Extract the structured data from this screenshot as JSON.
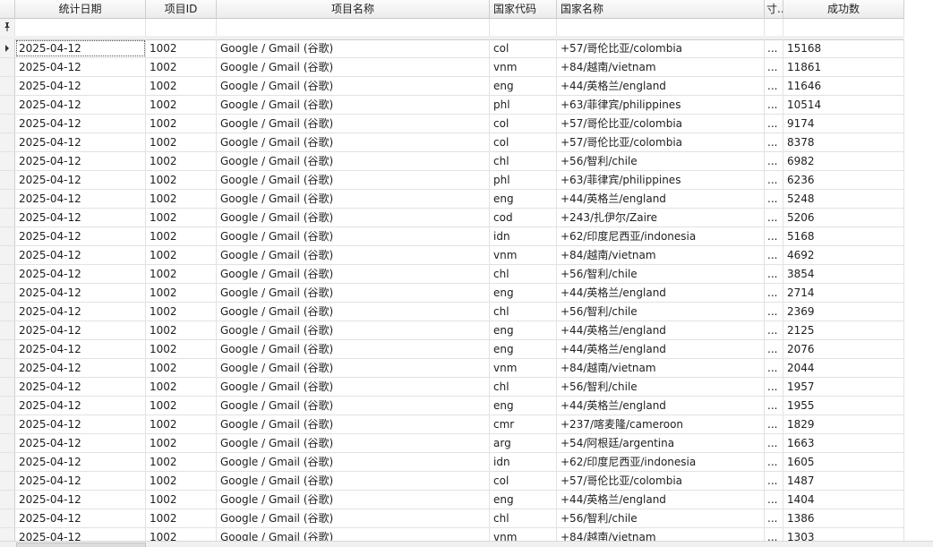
{
  "columns": {
    "date": "统计日期",
    "project_id": "项目ID",
    "project_name": "项目名称",
    "country_code": "国家代码",
    "country_name": "国家名称",
    "truncated": "寸..",
    "success_count": "成功数"
  },
  "filter_row": {
    "pin_icon": "pin-icon"
  },
  "rows": [
    {
      "date": "2025-04-12",
      "pid": "1002",
      "pname": "Google / Gmail (谷歌)",
      "code": "col",
      "country": "+57/哥伦比亚/colombia",
      "dots": "...",
      "succ": "15168"
    },
    {
      "date": "2025-04-12",
      "pid": "1002",
      "pname": "Google / Gmail (谷歌)",
      "code": "vnm",
      "country": "+84/越南/vietnam",
      "dots": "...",
      "succ": "11861"
    },
    {
      "date": "2025-04-12",
      "pid": "1002",
      "pname": "Google / Gmail (谷歌)",
      "code": "eng",
      "country": "+44/英格兰/england",
      "dots": "...",
      "succ": "11646"
    },
    {
      "date": "2025-04-12",
      "pid": "1002",
      "pname": "Google / Gmail (谷歌)",
      "code": "phl",
      "country": "+63/菲律宾/philippines",
      "dots": "...",
      "succ": "10514"
    },
    {
      "date": "2025-04-12",
      "pid": "1002",
      "pname": "Google / Gmail (谷歌)",
      "code": "col",
      "country": "+57/哥伦比亚/colombia",
      "dots": "...",
      "succ": "9174"
    },
    {
      "date": "2025-04-12",
      "pid": "1002",
      "pname": "Google / Gmail (谷歌)",
      "code": "col",
      "country": "+57/哥伦比亚/colombia",
      "dots": "...",
      "succ": "8378"
    },
    {
      "date": "2025-04-12",
      "pid": "1002",
      "pname": "Google / Gmail (谷歌)",
      "code": "chl",
      "country": "+56/智利/chile",
      "dots": "...",
      "succ": "6982"
    },
    {
      "date": "2025-04-12",
      "pid": "1002",
      "pname": "Google / Gmail (谷歌)",
      "code": "phl",
      "country": "+63/菲律宾/philippines",
      "dots": "...",
      "succ": "6236"
    },
    {
      "date": "2025-04-12",
      "pid": "1002",
      "pname": "Google / Gmail (谷歌)",
      "code": "eng",
      "country": "+44/英格兰/england",
      "dots": "...",
      "succ": "5248"
    },
    {
      "date": "2025-04-12",
      "pid": "1002",
      "pname": "Google / Gmail (谷歌)",
      "code": "cod",
      "country": "+243/扎伊尔/Zaire",
      "dots": "...",
      "succ": "5206"
    },
    {
      "date": "2025-04-12",
      "pid": "1002",
      "pname": "Google / Gmail (谷歌)",
      "code": "idn",
      "country": "+62/印度尼西亚/indonesia",
      "dots": "...",
      "succ": "5168"
    },
    {
      "date": "2025-04-12",
      "pid": "1002",
      "pname": "Google / Gmail (谷歌)",
      "code": "vnm",
      "country": "+84/越南/vietnam",
      "dots": "...",
      "succ": "4692"
    },
    {
      "date": "2025-04-12",
      "pid": "1002",
      "pname": "Google / Gmail (谷歌)",
      "code": "chl",
      "country": "+56/智利/chile",
      "dots": "...",
      "succ": "3854"
    },
    {
      "date": "2025-04-12",
      "pid": "1002",
      "pname": "Google / Gmail (谷歌)",
      "code": "eng",
      "country": "+44/英格兰/england",
      "dots": "...",
      "succ": "2714"
    },
    {
      "date": "2025-04-12",
      "pid": "1002",
      "pname": "Google / Gmail (谷歌)",
      "code": "chl",
      "country": "+56/智利/chile",
      "dots": "...",
      "succ": "2369"
    },
    {
      "date": "2025-04-12",
      "pid": "1002",
      "pname": "Google / Gmail (谷歌)",
      "code": "eng",
      "country": "+44/英格兰/england",
      "dots": "...",
      "succ": "2125"
    },
    {
      "date": "2025-04-12",
      "pid": "1002",
      "pname": "Google / Gmail (谷歌)",
      "code": "eng",
      "country": "+44/英格兰/england",
      "dots": "...",
      "succ": "2076"
    },
    {
      "date": "2025-04-12",
      "pid": "1002",
      "pname": "Google / Gmail (谷歌)",
      "code": "vnm",
      "country": "+84/越南/vietnam",
      "dots": "...",
      "succ": "2044"
    },
    {
      "date": "2025-04-12",
      "pid": "1002",
      "pname": "Google / Gmail (谷歌)",
      "code": "chl",
      "country": "+56/智利/chile",
      "dots": "...",
      "succ": "1957"
    },
    {
      "date": "2025-04-12",
      "pid": "1002",
      "pname": "Google / Gmail (谷歌)",
      "code": "eng",
      "country": "+44/英格兰/england",
      "dots": "...",
      "succ": "1955"
    },
    {
      "date": "2025-04-12",
      "pid": "1002",
      "pname": "Google / Gmail (谷歌)",
      "code": "cmr",
      "country": "+237/喀麦隆/cameroon",
      "dots": "...",
      "succ": "1829"
    },
    {
      "date": "2025-04-12",
      "pid": "1002",
      "pname": "Google / Gmail (谷歌)",
      "code": "arg",
      "country": "+54/阿根廷/argentina",
      "dots": "...",
      "succ": "1663"
    },
    {
      "date": "2025-04-12",
      "pid": "1002",
      "pname": "Google / Gmail (谷歌)",
      "code": "idn",
      "country": "+62/印度尼西亚/indonesia",
      "dots": "...",
      "succ": "1605"
    },
    {
      "date": "2025-04-12",
      "pid": "1002",
      "pname": "Google / Gmail (谷歌)",
      "code": "col",
      "country": "+57/哥伦比亚/colombia",
      "dots": "...",
      "succ": "1487"
    },
    {
      "date": "2025-04-12",
      "pid": "1002",
      "pname": "Google / Gmail (谷歌)",
      "code": "eng",
      "country": "+44/英格兰/england",
      "dots": "...",
      "succ": "1404"
    },
    {
      "date": "2025-04-12",
      "pid": "1002",
      "pname": "Google / Gmail (谷歌)",
      "code": "chl",
      "country": "+56/智利/chile",
      "dots": "...",
      "succ": "1386"
    },
    {
      "date": "2025-04-12",
      "pid": "1002",
      "pname": "Google / Gmail (谷歌)",
      "code": "vnm",
      "country": "+84/越南/vietnam",
      "dots": "...",
      "succ": "1303"
    }
  ]
}
